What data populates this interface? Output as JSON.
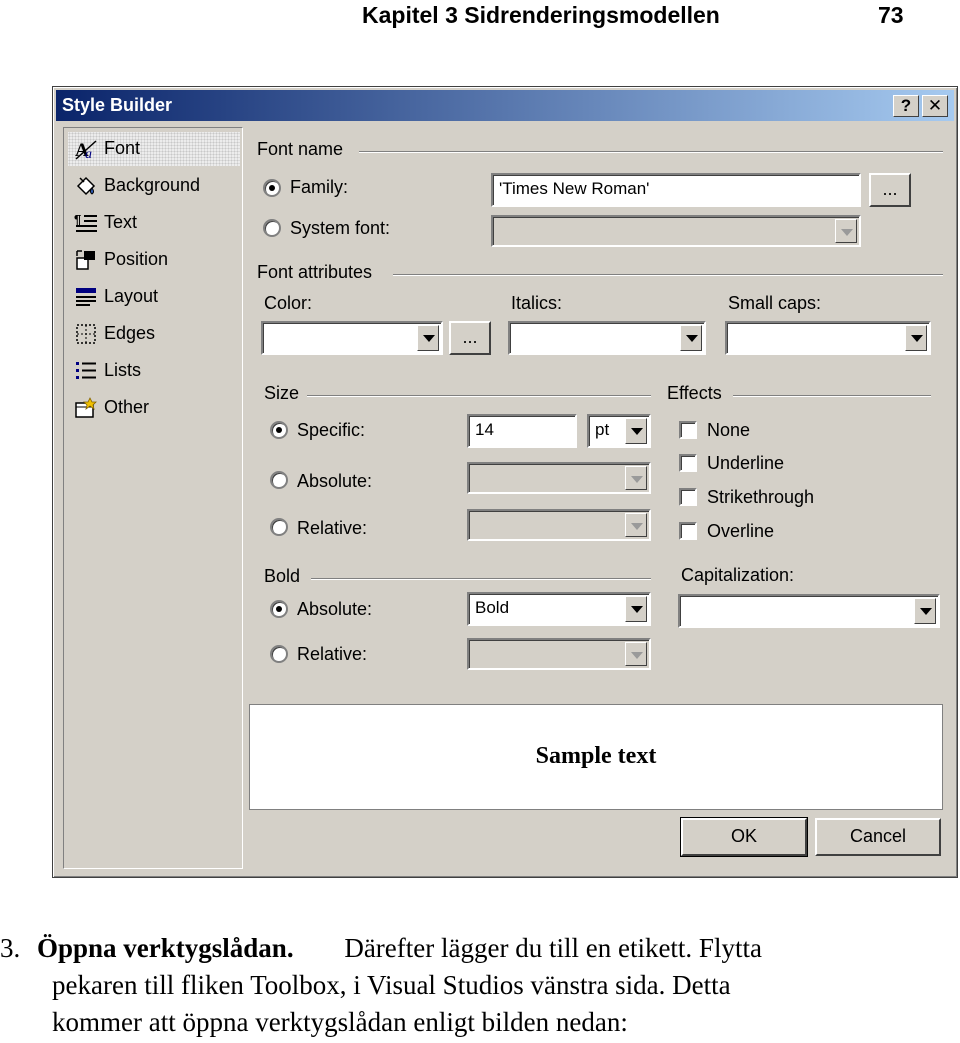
{
  "page_header": {
    "chapter": "Kapitel 3 Sidrenderingsmodellen",
    "page_number": "73"
  },
  "dialog": {
    "title": "Style Builder",
    "help_label": "?",
    "close_label": "✕",
    "nav": [
      {
        "label": "Font",
        "icon": "font-icon",
        "selected": true
      },
      {
        "label": "Background",
        "icon": "background-icon"
      },
      {
        "label": "Text",
        "icon": "text-icon"
      },
      {
        "label": "Position",
        "icon": "position-icon"
      },
      {
        "label": "Layout",
        "icon": "layout-icon"
      },
      {
        "label": "Edges",
        "icon": "edges-icon"
      },
      {
        "label": "Lists",
        "icon": "lists-icon"
      },
      {
        "label": "Other",
        "icon": "other-icon"
      }
    ],
    "font_name": {
      "group_label": "Font name",
      "family_label": "Family:",
      "family_value": "'Times New Roman'",
      "browse_label": "...",
      "system_font_label": "System font:",
      "system_font_value": ""
    },
    "font_attributes": {
      "group_label": "Font attributes",
      "color_label": "Color:",
      "color_value": "",
      "color_browse_label": "...",
      "italics_label": "Italics:",
      "italics_value": "",
      "small_caps_label": "Small caps:",
      "small_caps_value": ""
    },
    "size": {
      "group_label": "Size",
      "specific_label": "Specific:",
      "specific_value": "14",
      "unit_value": "pt",
      "absolute_label": "Absolute:",
      "relative_label": "Relative:"
    },
    "effects": {
      "group_label": "Effects",
      "none_label": "None",
      "underline_label": "Underline",
      "strikethrough_label": "Strikethrough",
      "overline_label": "Overline"
    },
    "bold": {
      "group_label": "Bold",
      "absolute_label": "Absolute:",
      "absolute_value": "Bold",
      "relative_label": "Relative:"
    },
    "capitalization": {
      "label": "Capitalization:",
      "value": ""
    },
    "preview_text": "Sample text",
    "ok_label": "OK",
    "cancel_label": "Cancel"
  },
  "body_text": {
    "step_number": "3.",
    "step_title": "Öppna verktygslådan.",
    "line1_rest": "Därefter lägger du till en etikett. Flytta",
    "line2": "pekaren till fliken Toolbox, i Visual Studios vänstra sida. Detta",
    "line3": "kommer att öppna verktygslådan enligt bilden nedan:"
  }
}
